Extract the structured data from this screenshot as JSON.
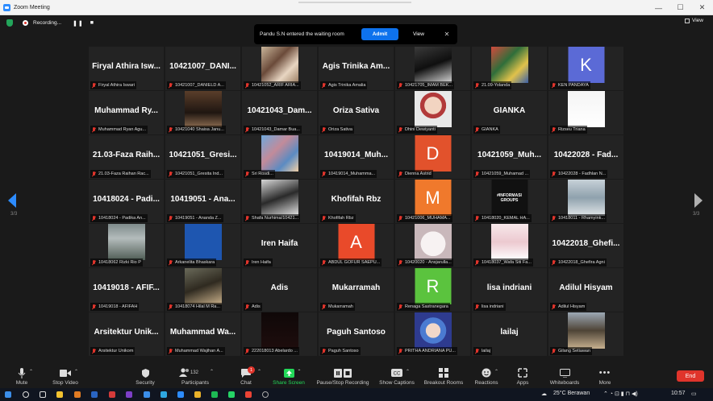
{
  "window": {
    "title": "Zoom Meeting",
    "controls": [
      "—",
      "☐",
      "✕"
    ]
  },
  "top": {
    "recording": "Recording...",
    "view": "View"
  },
  "toast": {
    "message": "Pandu S.N entered the waiting room",
    "admit": "Admit",
    "view": "View"
  },
  "pager": {
    "label": "3/3"
  },
  "tiles": [
    {
      "name": "Firyal Athira Isw...",
      "label": "Firyal Athira Iswari"
    },
    {
      "name": "10421007_DANI...",
      "label": "10421007_DANIELD A..."
    },
    {
      "name": "",
      "label": "10421052_ARIF ARIA..."
    },
    {
      "name": "Agis Trinika Am...",
      "label": "Agis Trinika Amalia"
    },
    {
      "name": "",
      "label": "10421705_IMAM BEK..."
    },
    {
      "name": "",
      "label": "21.09-Yolanda"
    },
    {
      "name": "",
      "label": "KEN PANDAYA",
      "letter": "K"
    },
    {
      "name": "Muhammad Ry...",
      "label": "Muhammad Ryan Agu..."
    },
    {
      "name": "",
      "label": "10421040 Shaisa Janu..."
    },
    {
      "name": "10421043_Dam...",
      "label": "10421043_Damar Bua..."
    },
    {
      "name": "Oriza Sativa",
      "label": "Oriza Sativa"
    },
    {
      "name": "",
      "label": "Dhini Dewiyanti"
    },
    {
      "name": "GIANKA",
      "label": "GIANKA"
    },
    {
      "name": "",
      "label": "Rizseu Triana"
    },
    {
      "name": "21.03-Faza Raih...",
      "label": "21.03-Faza Raihan Rac..."
    },
    {
      "name": "10421051_Gresi...",
      "label": "10421051_Gresita Ind..."
    },
    {
      "name": "",
      "label": "Sri Rosdi..."
    },
    {
      "name": "10419014_Muh...",
      "label": "10419014_Muhamma..."
    },
    {
      "name": "",
      "label": "Dienna Astrid",
      "letter": "D"
    },
    {
      "name": "10421059_Muh...",
      "label": "10421059_Muhamad ..."
    },
    {
      "name": "10422028 - Fad...",
      "label": "10422028 - Fadhlan N..."
    },
    {
      "name": "10418024 - Padi...",
      "label": "10418024 - Padika An..."
    },
    {
      "name": "10419051 - Ana...",
      "label": "10419051 - Ananda Z..."
    },
    {
      "name": "",
      "label": "Shafa Nurhima/10421..."
    },
    {
      "name": "Khofifah Rbz",
      "label": "Khofifah Rbz"
    },
    {
      "name": "",
      "label": "10421006_MUHAMA...",
      "letter": "M"
    },
    {
      "name": "",
      "label": "10418020_KEMAL HA...",
      "badge": "#INFORMASI GROUPS"
    },
    {
      "name": "",
      "label": "10418011 - Rhamyink..."
    },
    {
      "name": "",
      "label": "10418062 Rizki Rio P"
    },
    {
      "name": "",
      "label": "Arkanelita Bhaskara"
    },
    {
      "name": "Iren Haifa",
      "label": "Iren Haifa"
    },
    {
      "name": "",
      "label": "ABDUL GOFUR SAEPU...",
      "letter": "A"
    },
    {
      "name": "",
      "label": "10420020 - Ansjarulla..."
    },
    {
      "name": "",
      "label": "10418037_Wafa Siti Fa..."
    },
    {
      "name": "10422018_Ghefi...",
      "label": "10422018_Ghefira Agni"
    },
    {
      "name": "10419018 - AFIF...",
      "label": "10419018 - AFIFAH"
    },
    {
      "name": "",
      "label": "10418074 Hilal M Ra..."
    },
    {
      "name": "Adis",
      "label": "Adis"
    },
    {
      "name": "Mukarramah",
      "label": "Mukarramah"
    },
    {
      "name": "",
      "label": "Renaga Sastranegara",
      "letter": "R"
    },
    {
      "name": "lisa indriani",
      "label": "lisa indriani"
    },
    {
      "name": "Adilul Hisyam",
      "label": "Adilul Hisyam"
    },
    {
      "name": "Arsitektur Unik...",
      "label": "Arsitektur Unikom"
    },
    {
      "name": "Muhammad Wa...",
      "label": "Muhammad Wajihan A..."
    },
    {
      "name": "",
      "label": "222018013 Abelardo ..."
    },
    {
      "name": "Paguh Santoso",
      "label": "Paguh Santoso"
    },
    {
      "name": "",
      "label": "PRITHA ANDRIANA PU..."
    },
    {
      "name": "lailaj",
      "label": "lailaj"
    },
    {
      "name": "",
      "label": "Gilang Setiawan"
    }
  ],
  "toolbar": {
    "mute": "Mute",
    "stop_video": "Stop Video",
    "security": "Security",
    "participants": "Participants",
    "participants_count": "132",
    "chat": "Chat",
    "chat_badge": "1",
    "share": "Share Screen",
    "pause": "Pause/Stop Recording",
    "captions": "Show Captions",
    "breakout": "Breakout Rooms",
    "reactions": "Reactions",
    "apps": "Apps",
    "whiteboards": "Whiteboards",
    "more": "More",
    "end": "End"
  },
  "taskbar": {
    "weather": "25°C Berawan",
    "time": "10:57"
  },
  "colors": {
    "accent": "#0e72ed",
    "end": "#e0342b",
    "share": "#23d959"
  }
}
